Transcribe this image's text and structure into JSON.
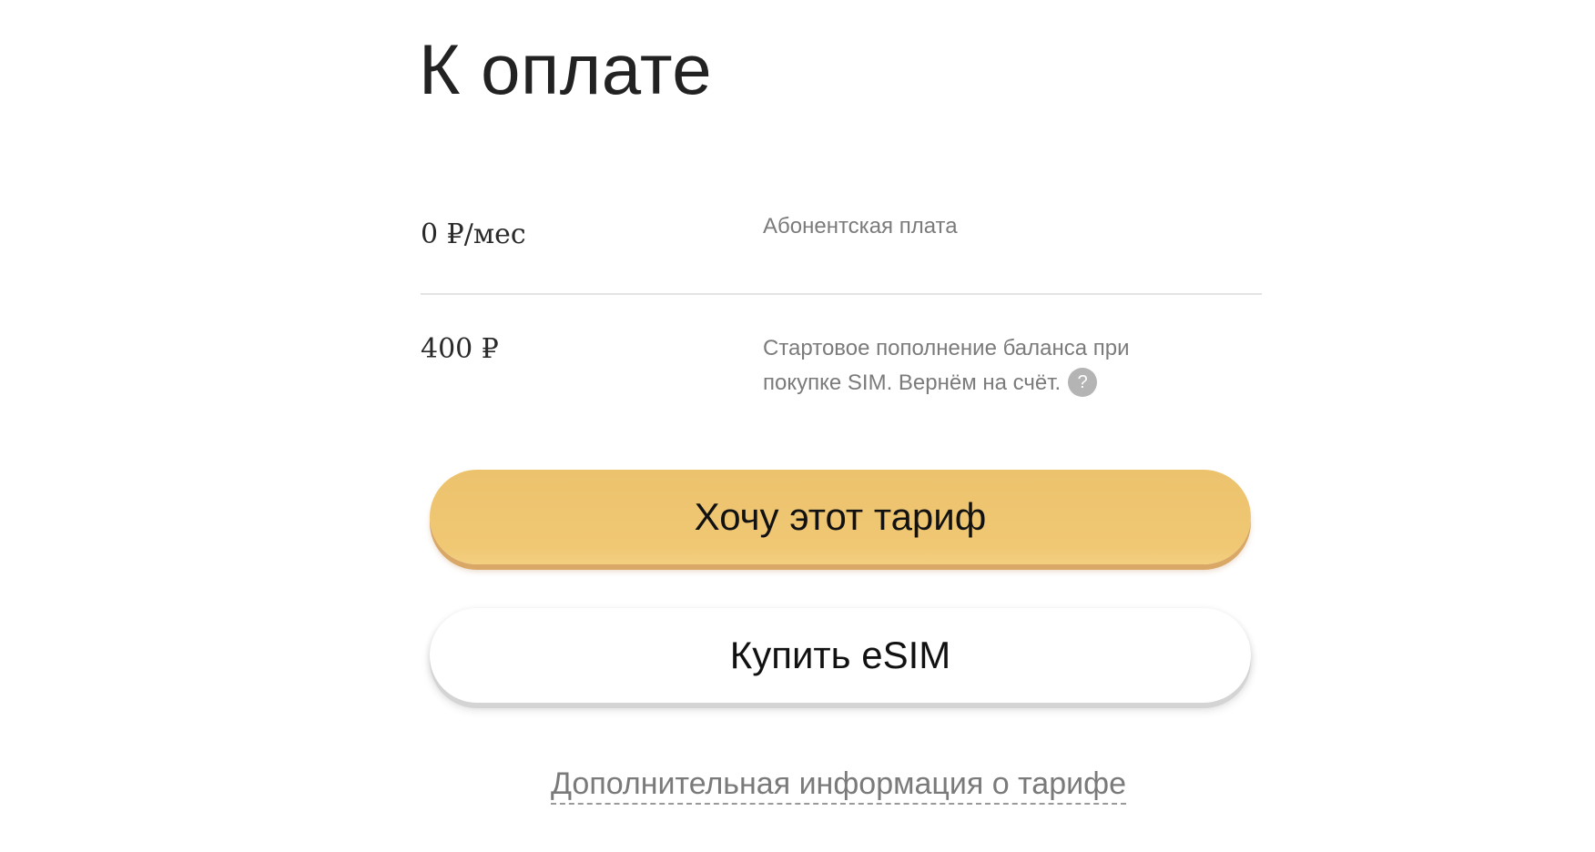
{
  "title": "К оплате",
  "rows": [
    {
      "amount": "0 ₽/мес",
      "description": "Абонентская плата"
    },
    {
      "amount": "400 ₽",
      "description": "Стартовое пополнение баланса при покупке SIM. Вернём на счёт."
    }
  ],
  "help_icon_glyph": "?",
  "buttons": {
    "primary_label": "Хочу этот тариф",
    "secondary_label": "Купить eSIM"
  },
  "more_info_link": "Дополнительная информация о тарифе",
  "colors": {
    "primary_button": "#f0c773",
    "secondary_button": "#ffffff",
    "muted_text": "#7b7b7b"
  }
}
